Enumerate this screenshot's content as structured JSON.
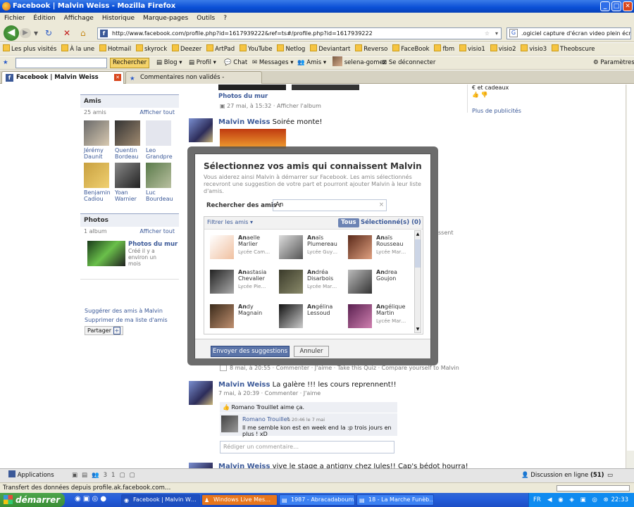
{
  "window": {
    "title": "Facebook | Malvin Weiss - Mozilla Firefox"
  },
  "menu": [
    "Fichier",
    "Édition",
    "Affichage",
    "Historique",
    "Marque-pages",
    "Outils",
    "?"
  ],
  "nav": {
    "url": "http://www.facebook.com/profile.php?id=1617939222&ref=ts#/profile.php?id=1617939222",
    "search": ".ogiciel capture d'écran video plein écran"
  },
  "bookmarks": [
    "Les plus visités",
    "À la une",
    "Hotmail",
    "skyrock",
    "Deezer",
    "ArtPad",
    "YouTube",
    "Netlog",
    "Deviantart",
    "Reverso",
    "FaceBook",
    "fbm",
    "visio1",
    "visio2",
    "visio3",
    "Theobscure"
  ],
  "toolbar2": {
    "search_btn": "Rechercher",
    "blog": "Blog",
    "profil": "Profil",
    "chat": "Chat",
    "messages": "Messages",
    "amis": "Amis",
    "user": "selena-gomez",
    "logout": "Se déconnecter",
    "settings": "Paramètres"
  },
  "tabs": [
    {
      "label": "Facebook | Malvin Weiss"
    },
    {
      "label": "Commentaires non validés - Skyrock.com"
    }
  ],
  "left": {
    "friends_head": "Amis",
    "friends_count": "25 amis",
    "show_all": "Afficher tout",
    "friends": [
      {
        "first": "Jérémy",
        "last": "Daunit"
      },
      {
        "first": "Quentin",
        "last": "Bordeau"
      },
      {
        "first": "Leo",
        "last": "Grandpre"
      },
      {
        "first": "Benjamin",
        "last": "Cadiou"
      },
      {
        "first": "Yoan",
        "last": "Warnier"
      },
      {
        "first": "Luc",
        "last": "Bourdeau"
      }
    ],
    "photos_head": "Photos",
    "album_count": "1 album",
    "album_title": "Photos du mur",
    "album_meta": "Créé il y a environ un mois",
    "suggest": "Suggérer des amis à Malvin",
    "remove": "Supprimer de ma liste d'amis",
    "share": "Partager"
  },
  "right": {
    "cadeaux": "€ et cadeaux",
    "more_ads": "Plus de publicités"
  },
  "feed": {
    "top_album": "Photos du mur",
    "top_meta": "27 mai, à 15:32 · Afficher l'album",
    "post1_name": "Malvin Weiss",
    "post1_text": "Soirée monte!",
    "quiz_meta": "8 mai, à 20:55 · Commenter · J'aime · Take this Quiz · Compare yourself to Malvin",
    "post2_name": "Malvin Weiss",
    "post2_text": "La galère !!! les cours reprennent!!",
    "post2_meta": "7 mai, à 20:39 · Commenter · J'aime",
    "like_text": "Romano Trouillet aime ça.",
    "commenter": "Romano Trouillet",
    "comment_time": "à 20:46 le 7 mai",
    "comment_text": "Il me semble kon est en week end la :p trois jours en plus ! xD",
    "comment_placeholder": "Rédiger un commentaire…",
    "post3_name": "Malvin Weiss",
    "post3_text": "vive le stage a antigny chez Jules!! Cap's bédot hourra!",
    "sent_fragment": "ssent"
  },
  "dialog": {
    "title": "Sélectionnez vos amis qui connaissent Malvin",
    "desc": "Vous aiderez ainsi Malvin à démarrer sur Facebook. Les amis sélectionnés recevront une suggestion de votre part et pourront ajouter Malvin à leur liste d'amis.",
    "search_label": "Rechercher des amis :",
    "search_value": "An",
    "filter": "Filtrer les amis",
    "tab_all": "Tous",
    "tab_selected": "Sélectionné(s) (0)",
    "people": [
      {
        "b": "An",
        "r": "aelle",
        "last": "Marlier",
        "school": "Lycée Cam…"
      },
      {
        "b": "An",
        "r": "aïs",
        "last": "Plumereau",
        "school": "Lycée Guy…"
      },
      {
        "b": "An",
        "r": "aïs",
        "last": "Rousseau",
        "school": "Lycée Mar…"
      },
      {
        "b": "An",
        "r": "astasia",
        "last": "Chevalier",
        "school": "Lycée Pie…"
      },
      {
        "b": "An",
        "r": "dréa",
        "last": "Disarbois",
        "school": "Lycée Mar…"
      },
      {
        "b": "An",
        "r": "drea",
        "last": "Goujon",
        "school": ""
      },
      {
        "b": "An",
        "r": "dy",
        "last": "Magnain",
        "school": ""
      },
      {
        "b": "An",
        "r": "gélina",
        "last": "Lessoud",
        "school": ""
      },
      {
        "b": "An",
        "r": "gélique",
        "last": "Martin",
        "school": "Lycée Mar…"
      }
    ],
    "send": "Envoyer des suggestions",
    "cancel": "Annuler"
  },
  "fbbar": {
    "apps": "Applications",
    "online": "Discussion en ligne",
    "online_count": "(51)"
  },
  "status": "Transfert des données depuis profile.ak.facebook.com…",
  "taskbar": {
    "start": "démarrer",
    "tasks": [
      "Facebook | Malvin W…",
      "Windows Live Mes…",
      "1987 - Abracadabouml",
      "18 - La Marche Funèb…"
    ],
    "lang": "FR",
    "clock": "22:33"
  }
}
